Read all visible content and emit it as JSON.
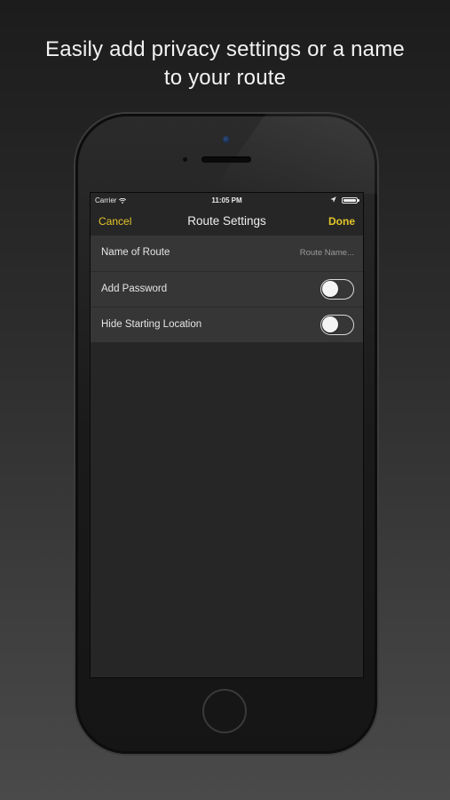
{
  "headline": {
    "line1": "Easily add privacy settings or a name",
    "line2": "to your route"
  },
  "status_bar": {
    "carrier": "Carrier",
    "time": "11:05 PM",
    "icons": [
      "wifi-icon",
      "location-arrow-icon",
      "battery-icon"
    ],
    "battery_level": 1.0
  },
  "nav_bar": {
    "cancel_label": "Cancel",
    "title": "Route Settings",
    "done_label": "Done"
  },
  "settings": {
    "rows": [
      {
        "label": "Name of Route",
        "type": "text",
        "value": "",
        "placeholder": "Route Name..."
      },
      {
        "label": "Add Password",
        "type": "toggle",
        "on": false
      },
      {
        "label": "Hide Starting Location",
        "type": "toggle",
        "on": false
      }
    ]
  },
  "colors": {
    "accent": "#e5c62a",
    "screen_background": "#262626",
    "row_background": "#363636",
    "text": "#e6e6e6"
  }
}
